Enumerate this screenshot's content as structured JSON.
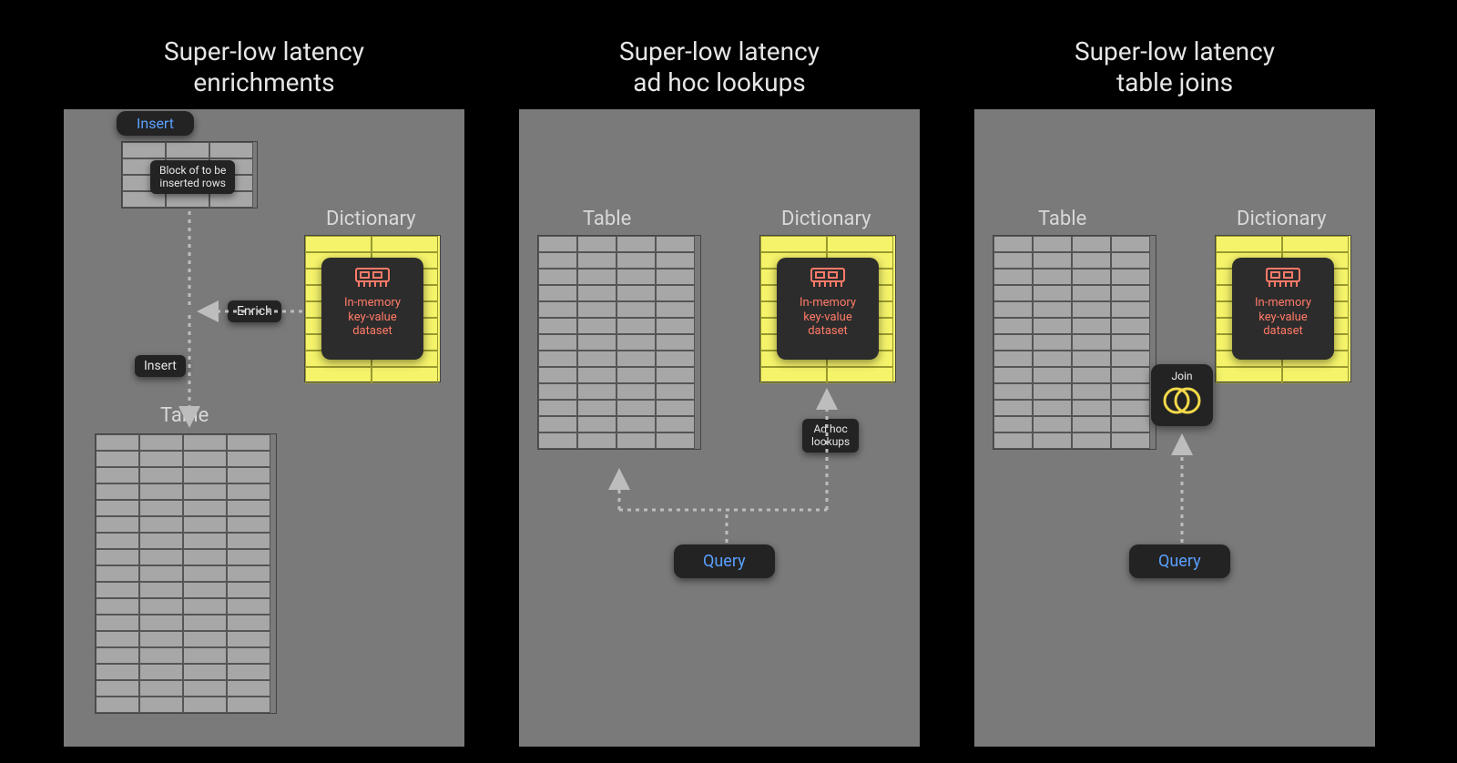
{
  "titles": {
    "panel1_line1": "Super-low latency",
    "panel1_line2": "enrichments",
    "panel2_line1": "Super-low latency",
    "panel2_line2": "ad hoc lookups",
    "panel3_line1": "Super-low latency",
    "panel3_line2": "table joins"
  },
  "labels": {
    "table": "Table",
    "dictionary": "Dictionary",
    "insert_top": "Insert",
    "block_rows_line1": "Block of to be",
    "block_rows_line2": "inserted rows",
    "enrich": "Enrich",
    "insert_small": "Insert",
    "adhoc_line1": "Ad hoc",
    "adhoc_line2": "lookups",
    "query": "Query",
    "join": "Join",
    "inmem_line1": "In-memory",
    "inmem_line2": "key-value",
    "inmem_line3": "dataset"
  },
  "colors": {
    "accent_blue": "#5aa0ff",
    "accent_red": "#ff7a68",
    "dict_yellow": "#f5f36a"
  }
}
